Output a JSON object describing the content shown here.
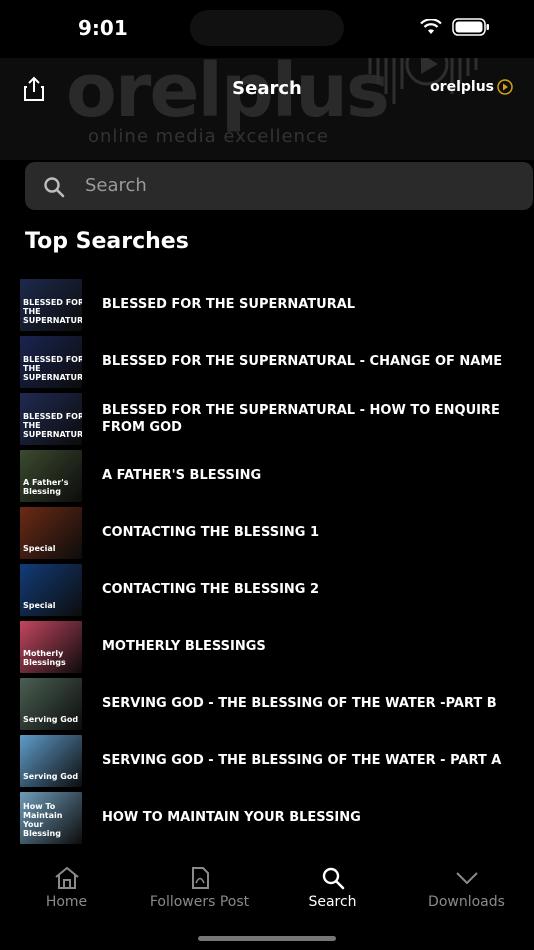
{
  "status": {
    "time": "9:01"
  },
  "header": {
    "title": "Search",
    "brand_bg": "orelplus",
    "brand_tagline": "online media excellence",
    "logo_small": "orelplus"
  },
  "search": {
    "placeholder": "Search"
  },
  "section_title": "Top Searches",
  "items": [
    {
      "label": "BLESSED FOR THE SUPERNATURAL",
      "thumb_color": "#1d2a4d",
      "thumb_text": "BLESSED FOR THE SUPERNATURAL"
    },
    {
      "label": "BLESSED FOR THE SUPERNATURAL - CHANGE OF NAME",
      "thumb_color": "#1a2450",
      "thumb_text": "BLESSED FOR THE SUPERNATURAL"
    },
    {
      "label": "BLESSED FOR THE SUPERNATURAL - HOW TO ENQUIRE FROM GOD",
      "thumb_color": "#202a52",
      "thumb_text": "BLESSED FOR THE SUPERNATURAL"
    },
    {
      "label": "A FATHER'S BLESSING",
      "thumb_color": "#3b4a2e",
      "thumb_text": "A Father's Blessing"
    },
    {
      "label": "CONTACTING THE BLESSING 1",
      "thumb_color": "#6b2a14",
      "thumb_text": "Special"
    },
    {
      "label": "CONTACTING THE BLESSING 2",
      "thumb_color": "#123c78",
      "thumb_text": "Special"
    },
    {
      "label": "MOTHERLY BLESSINGS",
      "thumb_color": "#c2455f",
      "thumb_text": "Motherly Blessings"
    },
    {
      "label": "SERVING GOD - THE BLESSING OF THE WATER -PART B",
      "thumb_color": "#4a5f52",
      "thumb_text": "Serving God"
    },
    {
      "label": "SERVING GOD - THE BLESSING OF THE WATER - PART A",
      "thumb_color": "#5f9cc9",
      "thumb_text": "Serving God"
    },
    {
      "label": "HOW TO MAINTAIN YOUR  BLESSING",
      "thumb_color": "#6f9cb8",
      "thumb_text": "How To Maintain Your Blessing"
    }
  ],
  "tabs": [
    {
      "label": "Home",
      "icon": "home-icon"
    },
    {
      "label": "Followers Post",
      "icon": "document-icon"
    },
    {
      "label": "Search",
      "icon": "search-icon"
    },
    {
      "label": "Downloads",
      "icon": "chevron-down-icon"
    }
  ],
  "active_tab": "Search"
}
